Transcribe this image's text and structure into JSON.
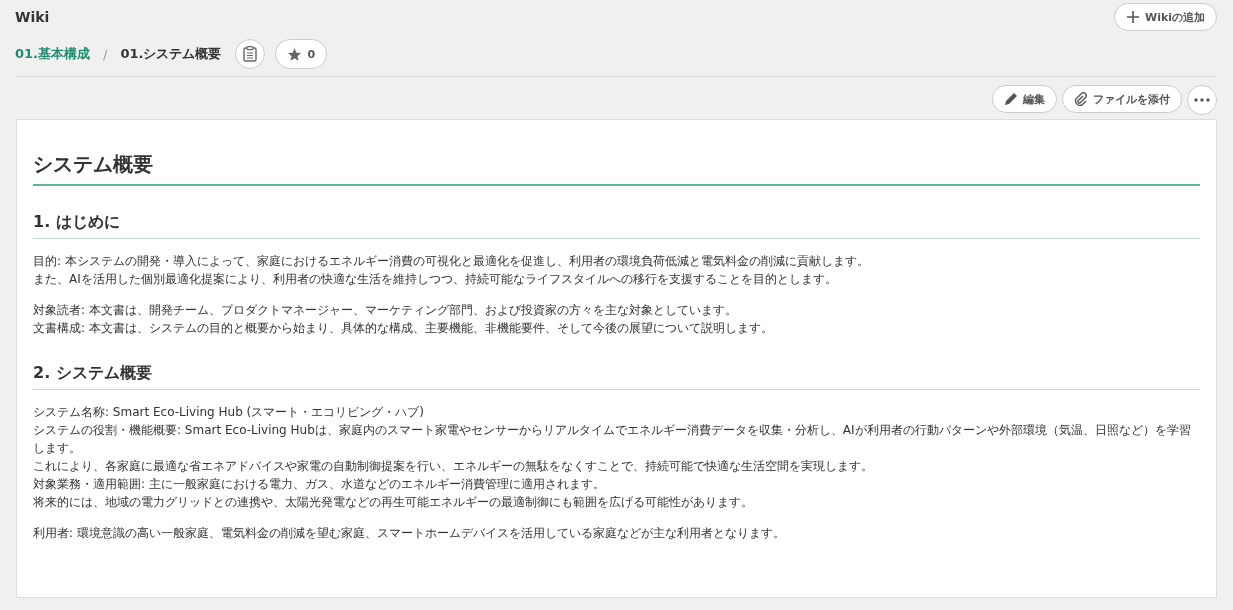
{
  "header": {
    "title": "Wiki",
    "add_button": "Wikiの追加"
  },
  "breadcrumb": {
    "parent": "01.基本構成",
    "separator": "/",
    "current": "01.システム概要",
    "star_count": "0"
  },
  "actions": {
    "edit": "編集",
    "attach": "ファイルを添付"
  },
  "document": {
    "title": "システム概要",
    "sections": [
      {
        "heading": "1. はじめに",
        "paragraphs": [
          [
            "目的: 本システムの開発・導入によって、家庭におけるエネルギー消費の可視化と最適化を促進し、利用者の環境負荷低減と電気料金の削減に貢献します。",
            "また、AIを活用した個別最適化提案により、利用者の快適な生活を維持しつつ、持続可能なライフスタイルへの移行を支援することを目的とします。"
          ],
          [
            "対象読者: 本文書は、開発チーム、プロダクトマネージャー、マーケティング部門、および投資家の方々を主な対象としています。",
            "文書構成: 本文書は、システムの目的と概要から始まり、具体的な構成、主要機能、非機能要件、そして今後の展望について説明します。"
          ]
        ]
      },
      {
        "heading": "2. システム概要",
        "paragraphs": [
          [
            "システム名称: Smart Eco-Living Hub (スマート・エコリビング・ハブ)",
            "システムの役割・機能概要: Smart Eco-Living Hubは、家庭内のスマート家電やセンサーからリアルタイムでエネルギー消費データを収集・分析し、AIが利用者の行動パターンや外部環境（気温、日照など）を学習します。",
            "これにより、各家庭に最適な省エネアドバイスや家電の自動制御提案を行い、エネルギーの無駄をなくすことで、持続可能で快適な生活空間を実現します。",
            "対象業務・適用範囲: 主に一般家庭における電力、ガス、水道などのエネルギー消費管理に適用されます。",
            "将来的には、地域の電力グリッドとの連携や、太陽光発電などの再生可能エネルギーの最適制御にも範囲を広げる可能性があります。"
          ],
          [
            "利用者: 環境意識の高い一般家庭、電気料金の削減を望む家庭、スマートホームデバイスを活用している家庭などが主な利用者となります。"
          ]
        ]
      }
    ]
  }
}
